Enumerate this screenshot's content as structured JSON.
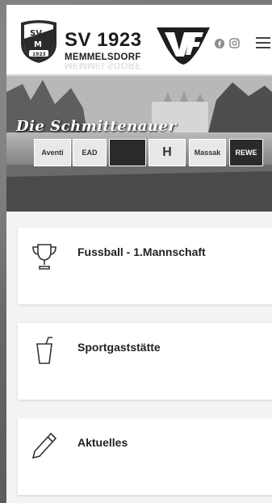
{
  "header": {
    "crest_text_top": "SV",
    "crest_text_mid": "M",
    "crest_year": "1923",
    "club_name": "SV 1923",
    "club_location": "MEMMELSDORF",
    "social": [
      "facebook-icon",
      "instagram-icon"
    ],
    "menu_icon": "hamburger-icon"
  },
  "banner": {
    "title": "Die Schmittenauer",
    "sponsors": [
      "Aventi",
      "EAD",
      "",
      "H",
      "Massak",
      "REWE"
    ]
  },
  "cards": [
    {
      "icon": "trophy-icon",
      "label": "Fussball - 1.Mannschaft"
    },
    {
      "icon": "cup-icon",
      "label": "Sportgaststätte"
    },
    {
      "icon": "pencil-icon",
      "label": "Aktuelles"
    }
  ],
  "colors": {
    "text": "#222222",
    "card_bg": "#ffffff",
    "page_bg": "#f3f3f3"
  }
}
